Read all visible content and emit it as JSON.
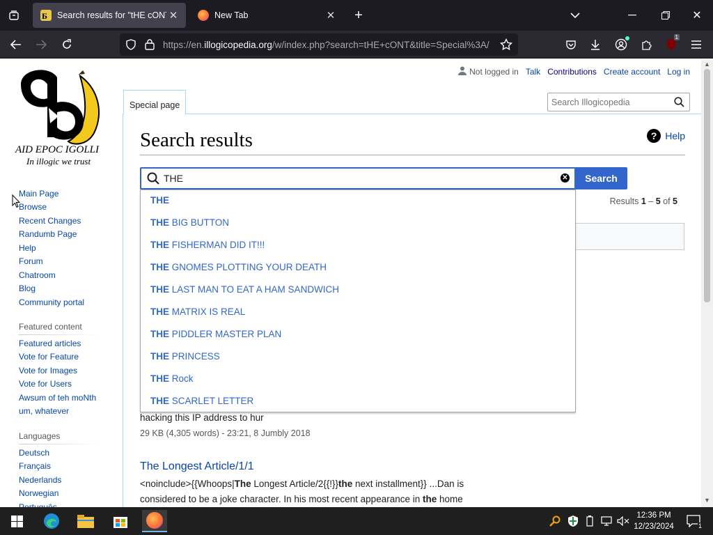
{
  "browser": {
    "tabs": [
      {
        "title": "Search results for \"tHE cONT\" – Illogicopedia",
        "active": true
      },
      {
        "title": "New Tab",
        "active": false
      }
    ],
    "url_prefix": "https://en.",
    "url_domain": "illogicopedia.org",
    "url_rest": "/w/index.php?search=tHE+cONT&title=Special%3A/",
    "extension_badge": "1"
  },
  "site": {
    "logo_line1": "AID EPOC IGOLLI",
    "logo_line2": "In illogic we trust",
    "personal": {
      "not_logged_in": "Not logged in",
      "talk": "Talk",
      "contributions": "Contributions",
      "create_account": "Create account",
      "log_in": "Log in"
    },
    "special_tab": "Special page",
    "search_placeholder": "Search Illogicopedia",
    "nav": [
      "Main Page",
      "Browse",
      "Recent Changes",
      "Randumb Page",
      "Help",
      "Forum",
      "Chatroom",
      "Blog",
      "Community portal"
    ],
    "featured_heading": "Featured content",
    "featured": [
      "Featured articles",
      "Vote for Feature",
      "Vote for Images",
      "Vote for Users",
      "Awsum of teh moNth",
      "um, whatever"
    ],
    "languages_heading": "Languages",
    "languages": [
      "Deutsch",
      "Français",
      "Nederlands",
      "Norwegian",
      "Português"
    ]
  },
  "main": {
    "title": "Search results",
    "help": "Help",
    "query": "THE",
    "search_button": "Search",
    "results_label": "Results",
    "results_from": "1",
    "results_to": "5",
    "results_of": "of",
    "results_total": "5",
    "suggestions": [
      {
        "bold": "THE",
        "rest": ""
      },
      {
        "bold": "THE",
        "rest": " BIG BUTTON"
      },
      {
        "bold": "THE",
        "rest": " FISHERMAN DID IT!!!"
      },
      {
        "bold": "THE",
        "rest": " GNOMES PLOTTING YOUR DEATH"
      },
      {
        "bold": "THE",
        "rest": " LAST MAN TO EAT A HAM SANDWICH"
      },
      {
        "bold": "THE",
        "rest": " MATRIX IS REAL"
      },
      {
        "bold": "THE",
        "rest": " PIDDLER MASTER PLAN"
      },
      {
        "bold": "THE",
        "rest": " PRINCESS"
      },
      {
        "bold": "THE",
        "rest": " Rock"
      },
      {
        "bold": "THE",
        "rest": " SCARLET LETTER"
      }
    ],
    "result1_snippet_tail": "hacking this IP address to hur",
    "result1_meta": "29 KB (4,305 words) - 23:21, 8 Jumbly 2018",
    "result2_title": "The Longest Article/1/1",
    "result2_line1_a": "<noinclude>{{Whoops|",
    "result2_line1_b": "The",
    "result2_line1_c": " Longest Article/2{{!}}",
    "result2_line1_d": "the",
    "result2_line1_e": " next installment}} ...Dan is",
    "result2_line2_a": "considered to be a joke character. In his most recent appearance in ",
    "result2_line2_b": "the",
    "result2_line2_c": " home"
  },
  "taskbar": {
    "time": "12:36 PM",
    "date": "12/23/2024",
    "notification_count": "1"
  }
}
